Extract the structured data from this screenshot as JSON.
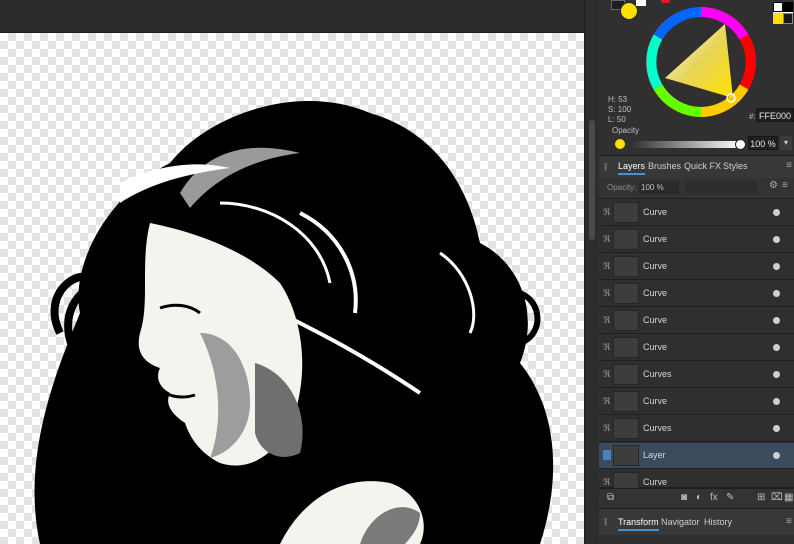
{
  "color": {
    "hsl": {
      "h": "H: 53",
      "s": "S: 100",
      "l": "L: 50"
    },
    "hex_prefix": "#:",
    "hex": "FFE000",
    "opacity_label": "Opacity",
    "opacity_value": "100 %",
    "current_color": "#ffe000"
  },
  "layers": {
    "tabs": [
      "Layers",
      "Brushes",
      "Quick FX",
      "Styles"
    ],
    "opacity_label": "Opacity:",
    "opacity_value": "100 % ",
    "items": [
      {
        "name": "Curve"
      },
      {
        "name": "Curve"
      },
      {
        "name": "Curve"
      },
      {
        "name": "Curve"
      },
      {
        "name": "Curve"
      },
      {
        "name": "Curve"
      },
      {
        "name": "Curves"
      },
      {
        "name": "Curve"
      },
      {
        "name": "Curves"
      },
      {
        "name": "Layer"
      },
      {
        "name": "Curve"
      }
    ]
  },
  "bottom_tabs": [
    "Transform",
    "Navigator",
    "History"
  ]
}
